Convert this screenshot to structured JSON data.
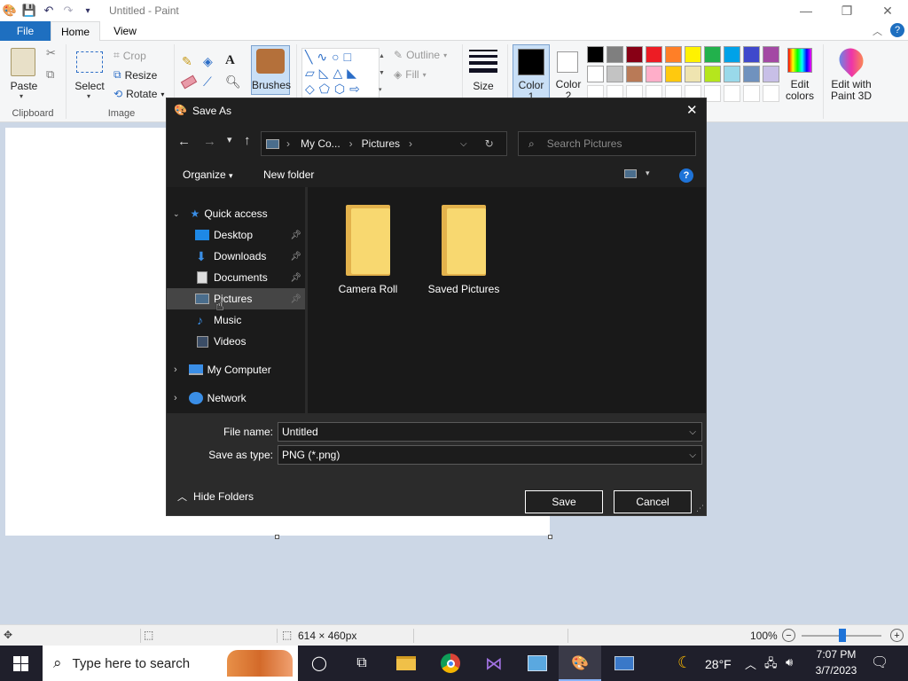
{
  "app": {
    "title": "Untitled - Paint",
    "minimize": "—",
    "restore": "❐",
    "close": "✕"
  },
  "ribbon_tabs": {
    "file": "File",
    "home": "Home",
    "view": "View"
  },
  "ribbon": {
    "clipboard": {
      "paste": "Paste",
      "label": "Clipboard"
    },
    "image": {
      "select": "Select",
      "crop": "Crop",
      "resize": "Resize",
      "rotate": "Rotate",
      "label": "Image"
    },
    "brushes": "Brushes",
    "shapes": {
      "outline": "Outline",
      "fill": "Fill"
    },
    "size": "Size",
    "color1": "Color 1",
    "color2": "Color 2",
    "edit_colors": "Edit colors",
    "edit_with_paint3d": "Edit with Paint 3D",
    "palette_row1": [
      "#000000",
      "#7f7f7f",
      "#880015",
      "#ed1c24",
      "#ff7f27",
      "#fff200",
      "#22b14c",
      "#00a2e8",
      "#3f48cc",
      "#a349a4"
    ],
    "palette_row2": [
      "#ffffff",
      "#c3c3c3",
      "#b97a57",
      "#ffaec9",
      "#ffc90e",
      "#efe4b0",
      "#b5e61d",
      "#99d9ea",
      "#7092be",
      "#c8bfe7"
    ]
  },
  "dialog": {
    "title": "Save As",
    "close": "✕",
    "address": {
      "part1": "My Co...",
      "part2": "Pictures"
    },
    "search_placeholder": "Search Pictures",
    "organize": "Organize",
    "new_folder": "New folder",
    "help": "?",
    "nav": {
      "quick_access": "Quick access",
      "items": [
        {
          "label": "Desktop",
          "icon": "desktop-icon",
          "pinned": true
        },
        {
          "label": "Downloads",
          "icon": "downloads-icon",
          "pinned": true
        },
        {
          "label": "Documents",
          "icon": "documents-icon",
          "pinned": true
        },
        {
          "label": "Pictures",
          "icon": "pictures-icon",
          "pinned": true
        },
        {
          "label": "Music",
          "icon": "music-icon",
          "pinned": false
        },
        {
          "label": "Videos",
          "icon": "videos-icon",
          "pinned": false
        }
      ],
      "my_computer": "My Computer",
      "network": "Network"
    },
    "folders": [
      "Camera Roll",
      "Saved Pictures"
    ],
    "file_name_label": "File name:",
    "file_name_value": "Untitled",
    "save_as_type_label": "Save as type:",
    "save_as_type_value": "PNG (*.png)",
    "hide_folders": "Hide Folders",
    "save": "Save",
    "cancel": "Cancel"
  },
  "statusbar": {
    "dimensions": "614 × 460px",
    "zoom": "100%"
  },
  "taskbar": {
    "search_placeholder": "Type here to search",
    "weather": "28°F",
    "time": "7:07 PM",
    "date": "3/7/2023"
  }
}
